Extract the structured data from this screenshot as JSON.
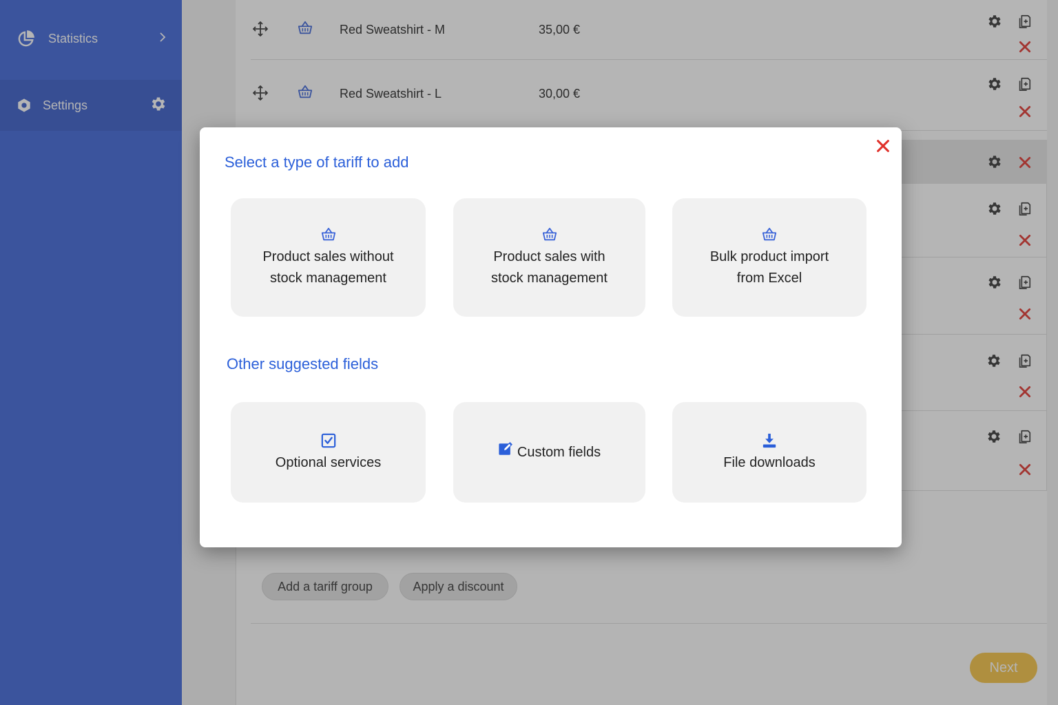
{
  "sidebar": {
    "items": [
      {
        "label": "Statistics"
      },
      {
        "label": "Settings"
      }
    ]
  },
  "tariffs": {
    "rows": [
      {
        "name": "Red Sweatshirt - M",
        "price": "35,00 €"
      },
      {
        "name": "Red Sweatshirt - L",
        "price": "30,00 €"
      }
    ]
  },
  "actions": {
    "add_group": "Add a tariff group",
    "apply_discount": "Apply a discount",
    "next": "Next"
  },
  "modal": {
    "title": "Select a type of tariff to add",
    "options": [
      {
        "line1": "Product sales without",
        "line2": "stock management",
        "icon": "basket-icon"
      },
      {
        "line1": "Product sales with",
        "line2": "stock management",
        "icon": "basket-icon"
      },
      {
        "line1": "Bulk product import",
        "line2": "from Excel",
        "icon": "basket-icon"
      }
    ],
    "subtitle": "Other suggested fields",
    "suggested": [
      {
        "label": "Optional services",
        "icon": "checkbox-icon"
      },
      {
        "label": "Custom fields",
        "icon": "edit-icon"
      },
      {
        "label": "File downloads",
        "icon": "download-icon"
      }
    ]
  },
  "colors": {
    "sidebar": "#3a63d8",
    "accent": "#2b5fd9",
    "danger": "#e0312a",
    "next": "#f5c242"
  }
}
